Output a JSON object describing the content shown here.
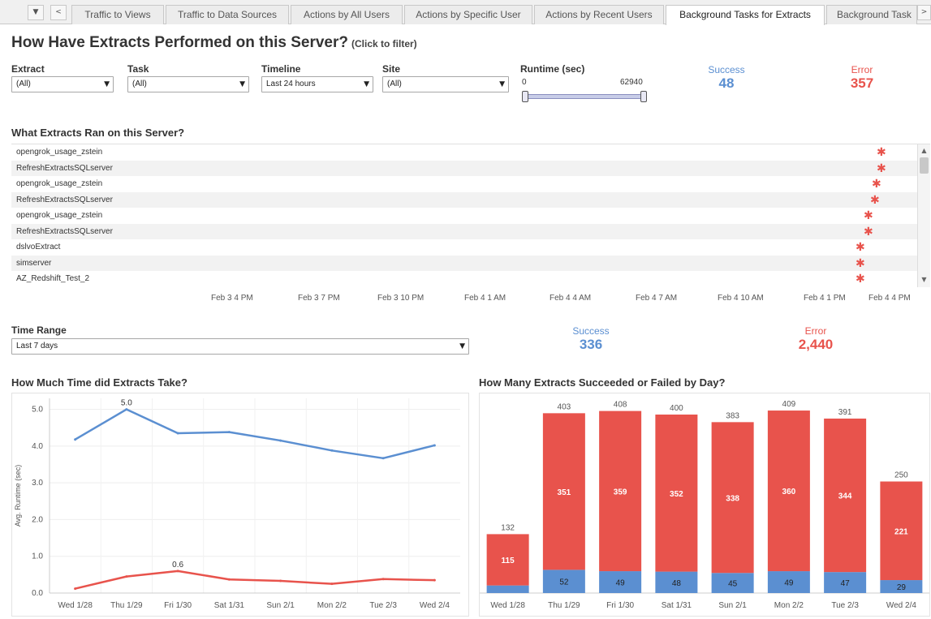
{
  "tabs": {
    "menu_icon": "▼",
    "prev_icon": "<",
    "next_icon": ">",
    "items": [
      {
        "label": "Traffic to Views"
      },
      {
        "label": "Traffic to Data Sources"
      },
      {
        "label": "Actions by All Users"
      },
      {
        "label": "Actions by Specific User"
      },
      {
        "label": "Actions by Recent Users"
      },
      {
        "label": "Background Tasks for Extracts",
        "active": true
      },
      {
        "label": "Background Task"
      }
    ]
  },
  "header": {
    "title": "How Have Extracts Performed on this Server?",
    "hint": "(Click to filter)"
  },
  "filters": {
    "extract": {
      "label": "Extract",
      "value": "(All)"
    },
    "task": {
      "label": "Task",
      "value": "(All)"
    },
    "timeline": {
      "label": "Timeline",
      "value": "Last 24 hours"
    },
    "site": {
      "label": "Site",
      "value": "(All)"
    },
    "runtime": {
      "label": "Runtime (sec)",
      "min": "0",
      "max": "62940"
    }
  },
  "kpi_top": {
    "success_label": "Success",
    "success_value": "48",
    "error_label": "Error",
    "error_value": "357"
  },
  "extracts_section": {
    "title": "What Extracts Ran on this Server?",
    "rows": [
      {
        "name": "opengrok_usage_zstein"
      },
      {
        "name": "RefreshExtractsSQLserver"
      },
      {
        "name": "opengrok_usage_zstein"
      },
      {
        "name": "RefreshExtractsSQLserver"
      },
      {
        "name": "opengrok_usage_zstein"
      },
      {
        "name": "RefreshExtractsSQLserver"
      },
      {
        "name": "dslvoExtract"
      },
      {
        "name": "simserver"
      },
      {
        "name": "AZ_Redshift_Test_2"
      }
    ],
    "time_ticks": [
      "Feb 3 4 PM",
      "Feb 3 7 PM",
      "Feb 3 10 PM",
      "Feb 4 1 AM",
      "Feb 4 4 AM",
      "Feb 4 7 AM",
      "Feb 4 10 AM",
      "Feb 4 1 PM",
      "Feb 4 4 PM"
    ],
    "scroll_up_icon": "▲",
    "scroll_down_icon": "▼"
  },
  "time_range": {
    "label": "Time Range",
    "value": "Last 7 days"
  },
  "kpi_bottom": {
    "success_label": "Success",
    "success_value": "336",
    "error_label": "Error",
    "error_value": "2,440"
  },
  "colors": {
    "success": "#5b8fd1",
    "error": "#e8534c"
  },
  "chart_data": [
    {
      "type": "line",
      "title": "How Much Time did Extracts Take?",
      "ylabel": "Avg. Runtime (sec)",
      "categories": [
        "Wed 1/28",
        "Thu 1/29",
        "Fri 1/30",
        "Sat 1/31",
        "Sun 2/1",
        "Mon 2/2",
        "Tue 2/3",
        "Wed 2/4"
      ],
      "y_ticks": [
        "0.0",
        "1.0",
        "2.0",
        "3.0",
        "4.0",
        "5.0"
      ],
      "ylim": [
        0,
        5.3
      ],
      "series": [
        {
          "color": "#5b8fd1",
          "values": [
            4.18,
            5.0,
            4.35,
            4.38,
            4.15,
            3.88,
            3.67,
            4.02
          ]
        },
        {
          "color": "#e8534c",
          "values": [
            0.12,
            0.45,
            0.6,
            0.37,
            0.33,
            0.25,
            0.38,
            0.35
          ]
        }
      ],
      "annotations": [
        {
          "series": 0,
          "index": 1,
          "text": "5.0"
        },
        {
          "series": 1,
          "index": 2,
          "text": "0.6"
        }
      ]
    },
    {
      "type": "bar",
      "title": "How Many Extracts Succeeded or Failed by Day?",
      "stacked": true,
      "categories": [
        "Wed 1/28",
        "Thu 1/29",
        "Fri 1/30",
        "Sat 1/31",
        "Sun 2/1",
        "Mon 2/2",
        "Tue 2/3",
        "Wed 2/4"
      ],
      "ylim": [
        0,
        440
      ],
      "series": [
        {
          "color": "#5b8fd1",
          "values": [
            17,
            52,
            49,
            48,
            45,
            49,
            47,
            29
          ],
          "labels": [
            "",
            "52",
            "49",
            "48",
            "45",
            "49",
            "47",
            "29"
          ]
        },
        {
          "color": "#e8534c",
          "values": [
            115,
            351,
            359,
            352,
            338,
            360,
            344,
            221
          ],
          "labels": [
            "115",
            "351",
            "359",
            "352",
            "338",
            "360",
            "344",
            "221"
          ]
        }
      ],
      "totals": [
        "132",
        "403",
        "408",
        "400",
        "383",
        "409",
        "391",
        "250"
      ]
    }
  ]
}
